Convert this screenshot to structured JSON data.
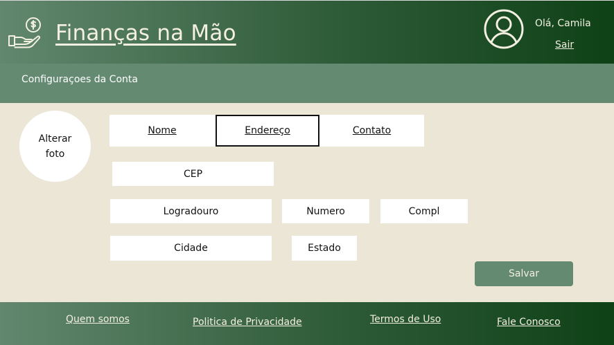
{
  "header": {
    "brand": "Finanças na Mão",
    "greeting": "Olá, Camila",
    "logout_label": "Sair"
  },
  "subheader": {
    "title": "Configuraçoes da Conta"
  },
  "profile": {
    "photo_label": "Alterar foto"
  },
  "tabs": [
    {
      "label": "Nome",
      "active": false
    },
    {
      "label": "Endereço",
      "active": true
    },
    {
      "label": "Contato",
      "active": false
    }
  ],
  "fields": {
    "cep": "CEP",
    "logradouro": "Logradouro",
    "numero": "Numero",
    "compl": "Compl",
    "cidade": "Cidade",
    "estado": "Estado"
  },
  "save_label": "Salvar",
  "footer": {
    "links": [
      "Quem somos",
      "Politica de Privacidade",
      "Termos de Uso",
      "Fale Conosco"
    ]
  },
  "colors": {
    "background": "#ece6d7",
    "header_dark": "#0f4116",
    "accent": "#648a72",
    "text_light": "#f3efe1"
  },
  "icons": [
    "money-hand-icon",
    "user-avatar-icon"
  ]
}
